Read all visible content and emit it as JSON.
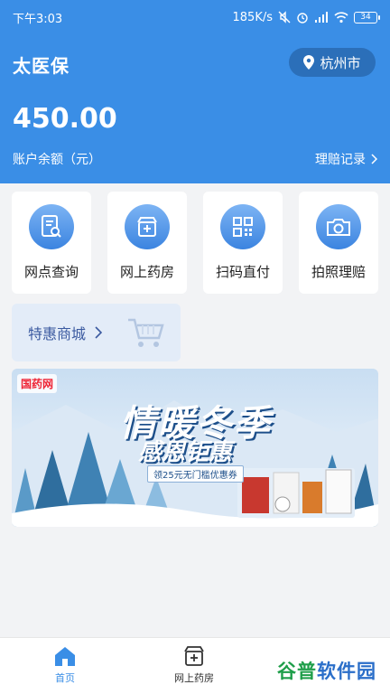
{
  "status_bar": {
    "time": "下午3:03",
    "network_speed": "185K/s",
    "battery_level": "34"
  },
  "header": {
    "app_title": "太医保",
    "city": "杭州市",
    "balance": "450.00",
    "balance_label": "账户余额（元）",
    "claims_link": "理赔记录"
  },
  "services": [
    {
      "label": "网点查询",
      "icon": "search-document-icon"
    },
    {
      "label": "网上药房",
      "icon": "pharmacy-store-icon"
    },
    {
      "label": "扫码直付",
      "icon": "qr-code-icon"
    },
    {
      "label": "拍照理赔",
      "icon": "camera-icon"
    }
  ],
  "mall": {
    "label": "特惠商城",
    "icon": "shopping-cart-icon"
  },
  "banner": {
    "logo_text": "国药网",
    "title": "情暖冬季",
    "subtitle": "感恩钜惠",
    "coupon_text": "领25元无门槛优惠券"
  },
  "tabbar": {
    "tabs": [
      {
        "label": "首页",
        "icon": "home-icon",
        "active": true
      },
      {
        "label": "网上药房",
        "icon": "pharmacy-store-icon",
        "active": false
      }
    ]
  },
  "watermark": {
    "part1": "谷普",
    "part2": "软件园"
  },
  "colors": {
    "primary": "#3a8ee6",
    "city_button": "#2b6fb9",
    "page_bg": "#f2f3f5"
  }
}
